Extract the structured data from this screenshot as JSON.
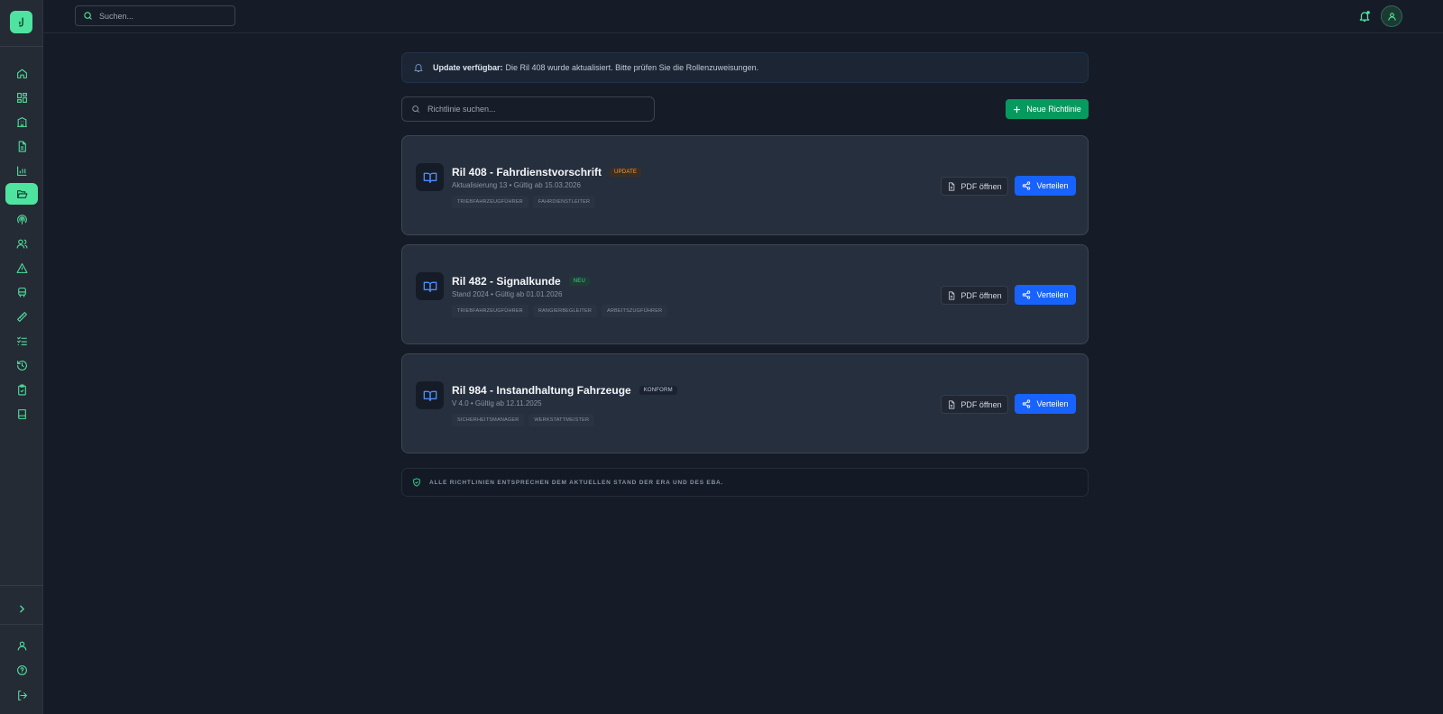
{
  "topbar": {
    "search_placeholder": "Suchen..."
  },
  "sidebar": {
    "items": [
      {
        "icon": "home-icon"
      },
      {
        "icon": "dashboard-icon"
      },
      {
        "icon": "building-icon"
      },
      {
        "icon": "document-icon"
      },
      {
        "icon": "bar-chart-icon"
      },
      {
        "icon": "folder-open-icon",
        "active": true
      },
      {
        "icon": "broadcast-icon"
      },
      {
        "icon": "users-icon"
      },
      {
        "icon": "warning-icon"
      },
      {
        "icon": "train-icon"
      },
      {
        "icon": "ruler-icon"
      },
      {
        "icon": "checklist-icon"
      },
      {
        "icon": "history-icon"
      },
      {
        "icon": "clipboard-check-icon"
      },
      {
        "icon": "book-icon"
      }
    ],
    "bottom_items": [
      {
        "icon": "chevron-right-icon"
      },
      {
        "icon": "user-icon"
      },
      {
        "icon": "help-icon"
      },
      {
        "icon": "logout-icon"
      }
    ]
  },
  "banner": {
    "strong": "Update verfügbar:",
    "text": "Die Ril 408 wurde aktualisiert. Bitte prüfen Sie die Rollenzuweisungen."
  },
  "main": {
    "search_placeholder": "Richtlinie suchen...",
    "new_button_label": "Neue Richtlinie"
  },
  "cards": [
    {
      "title": "Ril 408 - Fahrdienstvorschrift",
      "badge": "UPDATE",
      "badge_type": "update",
      "subtitle": "Aktualisierung 13 • Gültig ab 15.03.2026",
      "tags": [
        "TRIEBFAHRZEUGFÜHRER",
        "FAHRDIENSTLEITER"
      ],
      "pdf_label": "PDF öffnen",
      "share_label": "Verteilen"
    },
    {
      "title": "Ril 482 - Signalkunde",
      "badge": "NEU",
      "badge_type": "neu",
      "subtitle": "Stand 2024 • Gültig ab 01.01.2026",
      "tags": [
        "TRIEBFAHRZEUGFÜHRER",
        "RANGIERBEGLEITER",
        "ARBEITSZUGFÜHRER"
      ],
      "pdf_label": "PDF öffnen",
      "share_label": "Verteilen"
    },
    {
      "title": "Ril 984 - Instandhaltung Fahrzeuge",
      "badge": "KONFORM",
      "badge_type": "konform",
      "subtitle": "V 4.0 • Gültig ab 12.11.2025",
      "tags": [
        "SICHERHEITSMANAGER",
        "WERKSTATTMEISTER"
      ],
      "pdf_label": "PDF öffnen",
      "share_label": "Verteilen"
    }
  ],
  "footer_note": "ALLE RICHTLINIEN ENTSPRECHEN DEM AKTUELLEN STAND DER ERA UND DES EBA.",
  "colors": {
    "accent_green": "#4fe3a0",
    "primary_button": "#079a5f",
    "share_button": "#1863ff",
    "update_badge": "#f59e3c",
    "neu_badge": "#35d08d"
  }
}
